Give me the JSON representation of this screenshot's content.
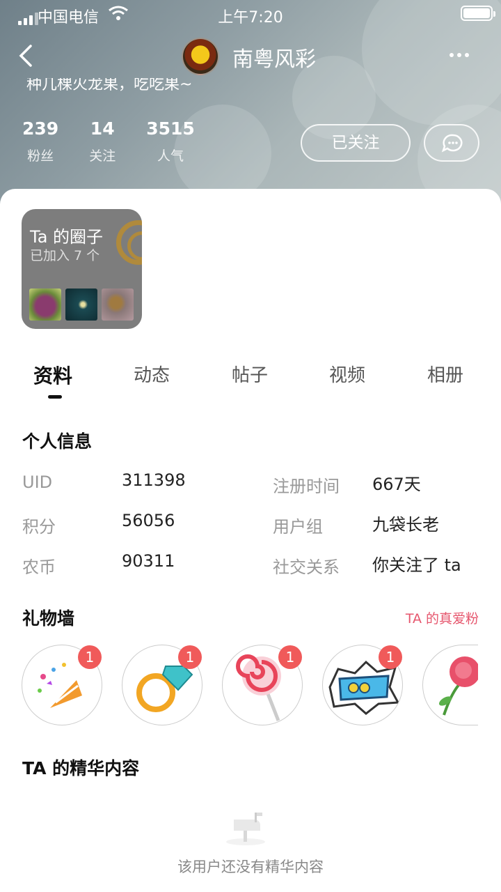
{
  "status_bar": {
    "carrier": "中国电信",
    "time": "上午7:20"
  },
  "profile": {
    "name": "南粤风彩",
    "signature": "种几棵火龙果，吃吃果~",
    "stats": [
      {
        "value": "239",
        "label": "粉丝"
      },
      {
        "value": "14",
        "label": "关注"
      },
      {
        "value": "3515",
        "label": "人气"
      }
    ],
    "follow_button": "已关注"
  },
  "circle_card": {
    "title": "Ta 的圈子",
    "subtitle": "已加入 7 个"
  },
  "tabs": [
    "资料",
    "动态",
    "帖子",
    "视频",
    "相册"
  ],
  "personal_info": {
    "title": "个人信息",
    "rows": [
      {
        "label": "UID",
        "value": "311398"
      },
      {
        "label": "注册时间",
        "value": "667天"
      },
      {
        "label": "积分",
        "value": "56056"
      },
      {
        "label": "用户组",
        "value": "九袋长老"
      },
      {
        "label": "农币",
        "value": "90311"
      },
      {
        "label": "社交关系",
        "value": "你关注了 ta"
      }
    ]
  },
  "gift_wall": {
    "title": "礼物墙",
    "link": "TA 的真爱粉",
    "gifts": [
      {
        "icon": "party-popper-icon",
        "count": "1"
      },
      {
        "icon": "diamond-ring-icon",
        "count": "1"
      },
      {
        "icon": "lollipop-icon",
        "count": "1"
      },
      {
        "icon": "cool-sticker-icon",
        "count": "1"
      },
      {
        "icon": "rose-icon",
        "count": ""
      }
    ]
  },
  "essence": {
    "title": "TA 的精华内容",
    "empty_text": "该用户还没有精华内容"
  },
  "colors": {
    "accent_red": "#e6566d",
    "badge_red": "#f05a5a"
  }
}
